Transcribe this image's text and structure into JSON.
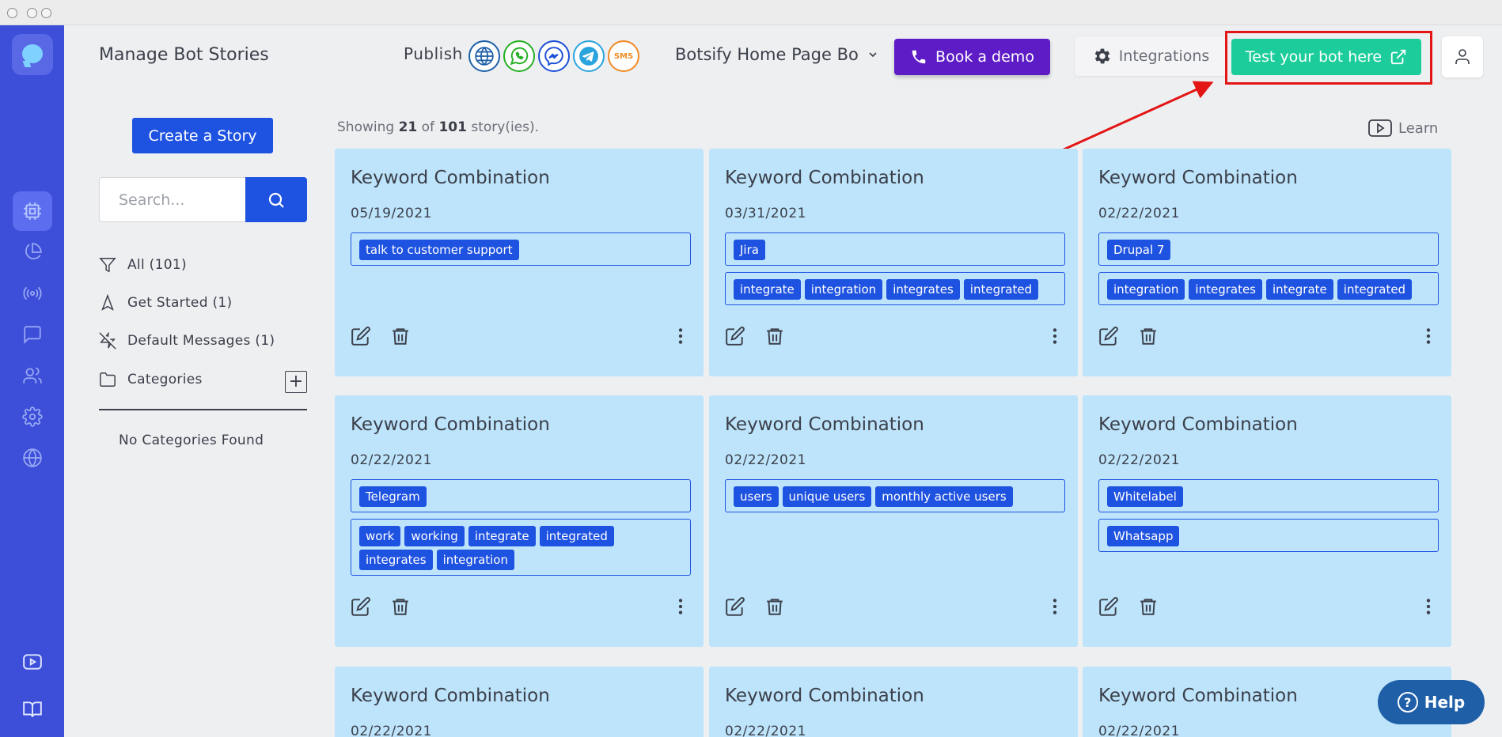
{
  "header": {
    "title": "Manage Bot Stories",
    "publish_label": "Publish",
    "channels": [
      {
        "name": "web",
        "color": "#1e5fa8"
      },
      {
        "name": "whatsapp",
        "color": "#25b024"
      },
      {
        "name": "messenger",
        "color": "#1b4fd6"
      },
      {
        "name": "telegram",
        "color": "#2aa4dc"
      },
      {
        "name": "sms",
        "color": "#f08a24",
        "label": "SMS"
      }
    ],
    "bot_selector": "Botsify Home Page Bo",
    "book_demo": "Book a demo",
    "integrations": "Integrations",
    "test_bot": "Test your bot here"
  },
  "left_panel": {
    "create_button": "Create a Story",
    "search_placeholder": "Search...",
    "filters": [
      {
        "label": "All (101)",
        "icon": "filter-icon"
      },
      {
        "label": "Get Started (1)",
        "icon": "navigation-icon"
      },
      {
        "label": "Default Messages (1)",
        "icon": "zap-off-icon"
      },
      {
        "label": "Categories",
        "icon": "folder-icon"
      }
    ],
    "no_categories": "No Categories Found"
  },
  "main": {
    "showing_prefix": "Showing",
    "showing_count": "21",
    "showing_of": "of",
    "showing_total": "101",
    "showing_suffix": "story(ies).",
    "learn": "Learn",
    "stories": [
      {
        "title": "Keyword Combination",
        "date": "05/19/2021",
        "groups": [
          [
            "talk to customer support"
          ]
        ]
      },
      {
        "title": "Keyword Combination",
        "date": "03/31/2021",
        "groups": [
          [
            "Jira"
          ],
          [
            "integrate",
            "integration",
            "integrates",
            "integrated"
          ]
        ]
      },
      {
        "title": "Keyword Combination",
        "date": "02/22/2021",
        "groups": [
          [
            "Drupal 7"
          ],
          [
            "integration",
            "integrates",
            "integrate",
            "integrated"
          ]
        ]
      },
      {
        "title": "Keyword Combination",
        "date": "02/22/2021",
        "groups": [
          [
            "Telegram"
          ],
          [
            "work",
            "working",
            "integrate",
            "integrated",
            "integrates",
            "integration"
          ]
        ]
      },
      {
        "title": "Keyword Combination",
        "date": "02/22/2021",
        "groups": [
          [
            "users",
            "unique users",
            "monthly active users"
          ]
        ]
      },
      {
        "title": "Keyword Combination",
        "date": "02/22/2021",
        "groups": [
          [
            "Whitelabel"
          ],
          [
            "Whatsapp"
          ]
        ]
      },
      {
        "title": "Keyword Combination",
        "date": "02/22/2021",
        "groups": []
      },
      {
        "title": "Keyword Combination",
        "date": "02/22/2021",
        "groups": []
      },
      {
        "title": "Keyword Combination",
        "date": "02/22/2021",
        "groups": []
      }
    ]
  },
  "help_button": "Help"
}
